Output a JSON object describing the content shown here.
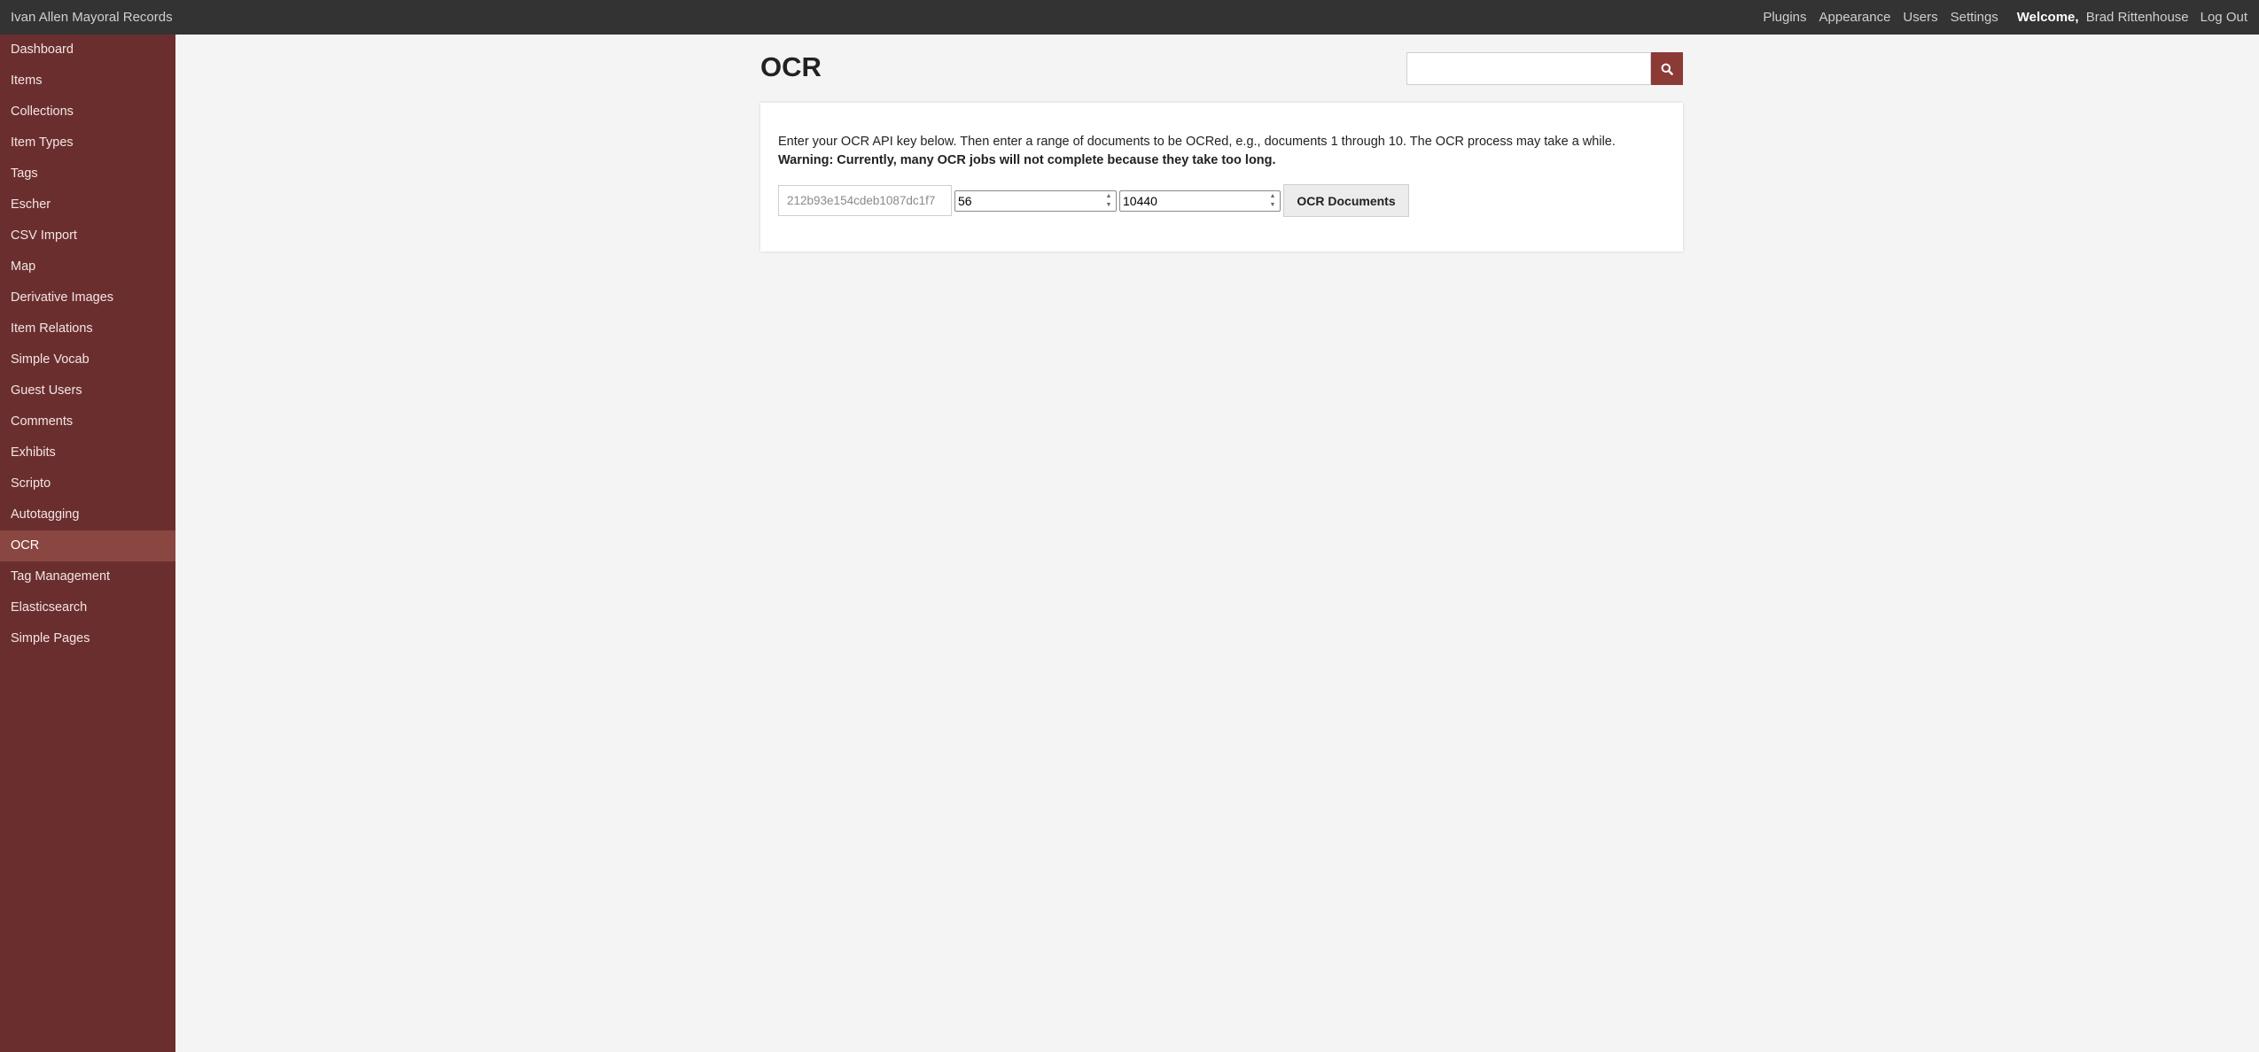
{
  "header": {
    "site_title": "Ivan Allen Mayoral Records",
    "nav": [
      "Plugins",
      "Appearance",
      "Users",
      "Settings"
    ],
    "welcome_label": "Welcome,",
    "user_name": "Brad Rittenhouse",
    "logout": "Log Out"
  },
  "sidebar": {
    "items": [
      "Dashboard",
      "Items",
      "Collections",
      "Item Types",
      "Tags",
      "Escher",
      "CSV Import",
      "Map",
      "Derivative Images",
      "Item Relations",
      "Simple Vocab",
      "Guest Users",
      "Comments",
      "Exhibits",
      "Scripto",
      "Autotagging",
      "OCR",
      "Tag Management",
      "Elasticsearch",
      "Simple Pages"
    ],
    "active": "OCR"
  },
  "main": {
    "title": "OCR",
    "search": {
      "value": "",
      "icon": "search-icon"
    },
    "instructions": "Enter your OCR API key below. Then enter a range of documents to be OCRed, e.g., documents 1 through 10. The OCR process may take a while.",
    "warning": "Warning: Currently, many OCR jobs will not complete because they take too long.",
    "form": {
      "api_key_value": "212b93e154cdeb1087dc1f7",
      "start_value": "56",
      "end_value": "10440",
      "submit_label": "OCR Documents"
    }
  },
  "colors": {
    "topbar": "#333333",
    "sidebar": "#6b2e2e",
    "sidebar_active": "#8a4640",
    "accent": "#8b3a36",
    "page_bg": "#f4f4f4"
  }
}
